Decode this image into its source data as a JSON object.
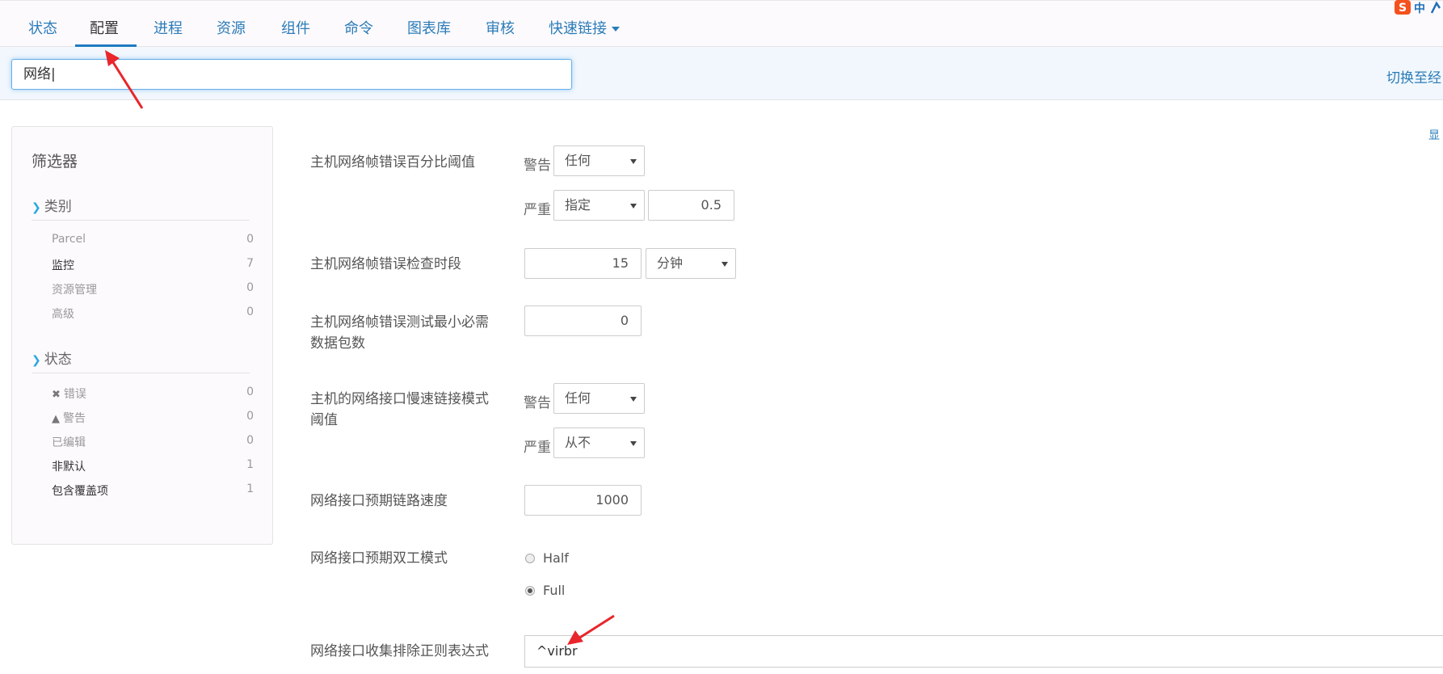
{
  "nav": {
    "tabs": [
      "状态",
      "配置",
      "进程",
      "资源",
      "组件",
      "命令",
      "图表库",
      "审核",
      "快速链接"
    ],
    "active_index": 1
  },
  "ime": {
    "label": "中"
  },
  "search": {
    "value": "网络"
  },
  "switch_link": "切换至经",
  "show_link": "显",
  "filter": {
    "title": "筛选器",
    "category": {
      "heading": "类别",
      "items": [
        {
          "label": "Parcel",
          "count": "0"
        },
        {
          "label": "监控",
          "count": "7"
        },
        {
          "label": "资源管理",
          "count": "0"
        },
        {
          "label": "高级",
          "count": "0"
        }
      ]
    },
    "status": {
      "heading": "状态",
      "items": [
        {
          "label": "错误",
          "count": "0"
        },
        {
          "label": "警告",
          "count": "0"
        },
        {
          "label": "已编辑",
          "count": "0"
        },
        {
          "label": "非默认",
          "count": "1"
        },
        {
          "label": "包含覆盖项",
          "count": "1"
        }
      ]
    }
  },
  "settings": {
    "frame_error_pct": {
      "label": "主机网络帧错误百分比阈值",
      "warn_label": "警告",
      "warn_value": "任何",
      "crit_label": "严重",
      "crit_value": "指定",
      "crit_number": "0.5"
    },
    "frame_error_window": {
      "label": "主机网络帧错误检查时段",
      "value": "15",
      "unit": "分钟"
    },
    "frame_error_min_packets": {
      "label_line1": "主机网络帧错误测试最小必需",
      "label_line2": "数据包数",
      "value": "0"
    },
    "slow_link": {
      "label_line1": "主机的网络接口慢速链接模式",
      "label_line2": "阈值",
      "warn_label": "警告",
      "warn_value": "任何",
      "crit_label": "严重",
      "crit_value": "从不"
    },
    "link_speed": {
      "label": "网络接口预期链路速度",
      "value": "1000"
    },
    "duplex": {
      "label": "网络接口预期双工模式",
      "options": [
        "Half",
        "Full"
      ],
      "selected": "Full"
    },
    "exclude_regex": {
      "label": "网络接口收集排除正则表达式",
      "value": "^virbr"
    }
  },
  "colors": {
    "accent": "#1f7bbf",
    "link": "#2b7cb8",
    "annotation_arrow": "#e8262b"
  }
}
